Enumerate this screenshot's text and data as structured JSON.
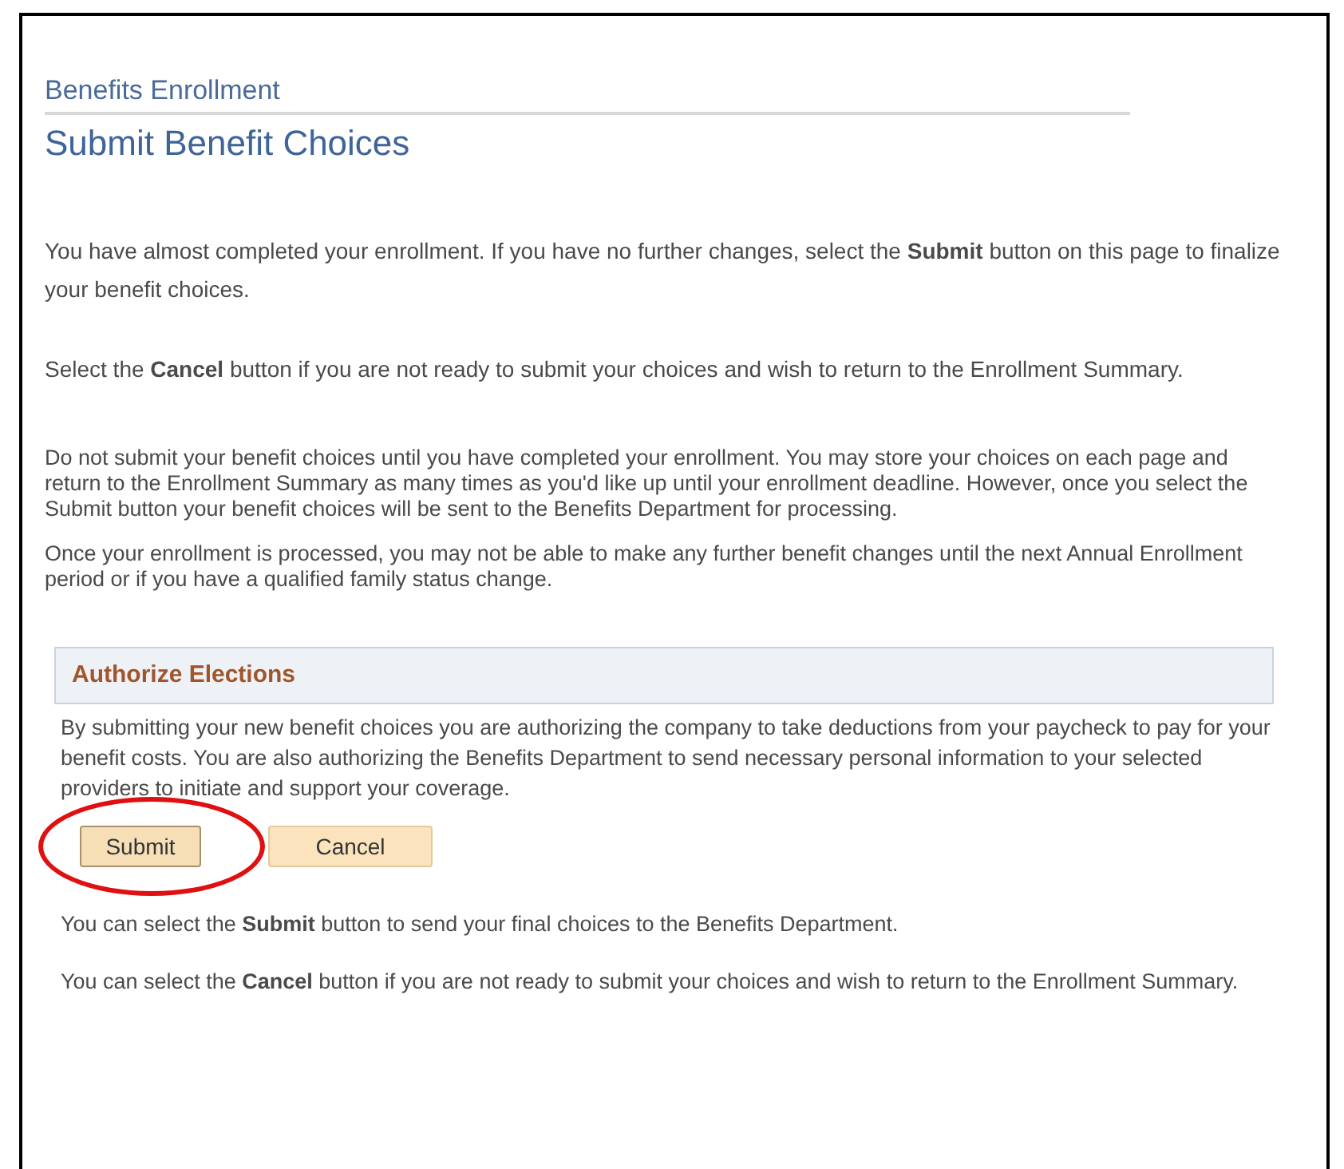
{
  "breadcrumb": "Benefits Enrollment",
  "title": "Submit Benefit Choices",
  "intro": [
    "You have almost completed your enrollment. If you have no further changes, select the **Submit** button on this page to finalize your benefit choices.",
    "Select the **Cancel** button if you are not ready to submit your choices and wish to return to the Enrollment Summary."
  ],
  "notes": [
    "Do not submit your benefit choices until you have completed your enrollment. You may store your choices on each page and return to the Enrollment Summary as many times as you'd like up until your enrollment deadline. However, once you select the Submit button your benefit choices will be sent to the Benefits Department for processing.",
    "Once your enrollment is processed, you may not be able to make any further benefit changes until the next Annual Enrollment period or if you have a qualified family status change."
  ],
  "section": {
    "title": "Authorize Elections",
    "text": "By submitting your new benefit choices you are authorizing the company to take deductions from your paycheck to pay for your benefit costs. You are also authorizing the Benefits Department to send necessary personal information to your selected providers to initiate and support your coverage."
  },
  "buttons": [
    {
      "label": "Submit",
      "highlighted": true
    },
    {
      "label": "Cancel",
      "highlighted": false
    }
  ],
  "footer": [
    "You can select the **Submit** button to send your final choices to the Benefits Department.",
    "You can select the **Cancel** button if you are not ready to submit your choices and wish to return to the Enrollment Summary."
  ]
}
